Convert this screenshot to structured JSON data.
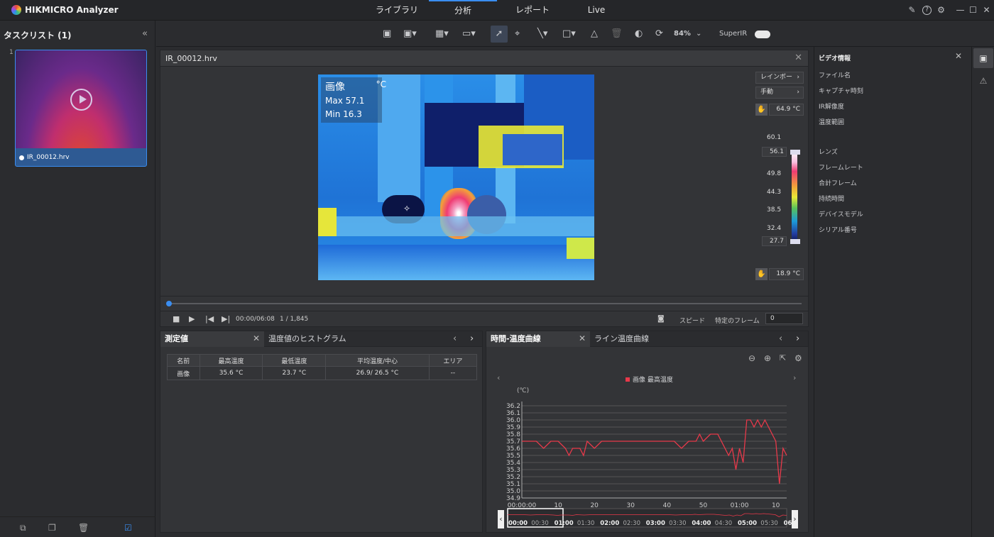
{
  "app": {
    "title": "HIKMICRO Analyzer"
  },
  "nav": {
    "tabs": [
      {
        "label": "ライブラリ"
      },
      {
        "label": "分析"
      },
      {
        "label": "レポート"
      },
      {
        "label": "Live"
      }
    ]
  },
  "sidebar": {
    "title": "タスクリスト (1)",
    "items": [
      {
        "index": "1",
        "name": "IR_00012.hrv"
      }
    ]
  },
  "toolbar": {
    "zoom": "84%",
    "superir_label": "SuperIR",
    "superir_on": true
  },
  "viewer": {
    "title": "IR_00012.hrv",
    "overlay": {
      "label": "画像",
      "unit": "°C",
      "max": "Max 57.1",
      "min": "Min 16.3"
    },
    "palette_button": "レインボー",
    "mode_button": "手動",
    "scale": {
      "top": "64.9 °C",
      "bottom": "18.9 °C",
      "upper_marker": "56.1",
      "lower_marker": "27.7",
      "ticks": [
        "60.1",
        "49.8",
        "44.3",
        "38.5",
        "32.4"
      ]
    },
    "playback": {
      "time": "00:00/06:08",
      "frame": "1 / 1,845",
      "speed_label": "スピード",
      "goto_label": "特定のフレーム",
      "goto_value": "0",
      "progress": 0
    }
  },
  "measure_panel": {
    "tabs": [
      "測定値",
      "温度値のヒストグラム"
    ],
    "columns": [
      "名前",
      "最高温度",
      "最低温度",
      "平均温度/中心",
      "エリア"
    ],
    "rows": [
      [
        "画像",
        "35.6 °C",
        "23.7 °C",
        "26.9/ 26.5 °C",
        "--"
      ]
    ]
  },
  "curve_panel": {
    "tabs": [
      "時間-温度曲線",
      "ライン温度曲線"
    ],
    "legend": "画像 最高温度",
    "yunit": "(℃)"
  },
  "chart_data": {
    "type": "line",
    "title": "",
    "xlabel": "",
    "ylabel": "(℃)",
    "ylim": [
      34.9,
      36.2
    ],
    "yticks": [
      "36.2",
      "36.1",
      "36.0",
      "35.9",
      "35.8",
      "35.7",
      "35.6",
      "35.5",
      "35.4",
      "35.3",
      "35.2",
      "35.1",
      "35.0",
      "34.9"
    ],
    "xticks": [
      "00:00:00",
      "10",
      "20",
      "30",
      "40",
      "50",
      "01:00",
      "10"
    ],
    "series": [
      {
        "name": "画像 最高温度",
        "color": "#e8394a",
        "x": [
          0,
          2,
          4,
          6,
          8,
          10,
          12,
          13,
          14,
          16,
          17,
          18,
          20,
          22,
          24,
          26,
          28,
          30,
          32,
          34,
          36,
          38,
          40,
          42,
          44,
          46,
          48,
          49,
          50,
          52,
          54,
          55,
          56,
          57,
          58,
          59,
          60,
          61,
          62,
          63,
          64,
          65,
          66,
          67,
          68,
          69,
          70,
          71,
          72,
          73
        ],
        "values": [
          35.7,
          35.7,
          35.7,
          35.6,
          35.7,
          35.7,
          35.6,
          35.5,
          35.6,
          35.6,
          35.5,
          35.7,
          35.6,
          35.7,
          35.7,
          35.7,
          35.7,
          35.7,
          35.7,
          35.7,
          35.7,
          35.7,
          35.7,
          35.7,
          35.6,
          35.7,
          35.7,
          35.8,
          35.7,
          35.8,
          35.8,
          35.7,
          35.6,
          35.5,
          35.6,
          35.3,
          35.6,
          35.4,
          36.0,
          36.0,
          35.9,
          36.0,
          35.9,
          36.0,
          35.9,
          35.8,
          35.7,
          35.1,
          35.6,
          35.5
        ]
      }
    ]
  },
  "overview": {
    "ticks": [
      "00:00",
      "00:30",
      "01:00",
      "01:30",
      "02:00",
      "02:30",
      "03:00",
      "03:30",
      "04:00",
      "04:30",
      "05:00",
      "05:30",
      "06"
    ]
  },
  "video_info": {
    "title": "ビデオ情報",
    "fields": [
      "ファイル名",
      "キャプチャ時刻",
      "IR解像度",
      "温度範囲",
      "レンズ",
      "フレームレート",
      "合計フレーム",
      "持続時間",
      "デバイスモデル",
      "シリアル番号"
    ]
  }
}
